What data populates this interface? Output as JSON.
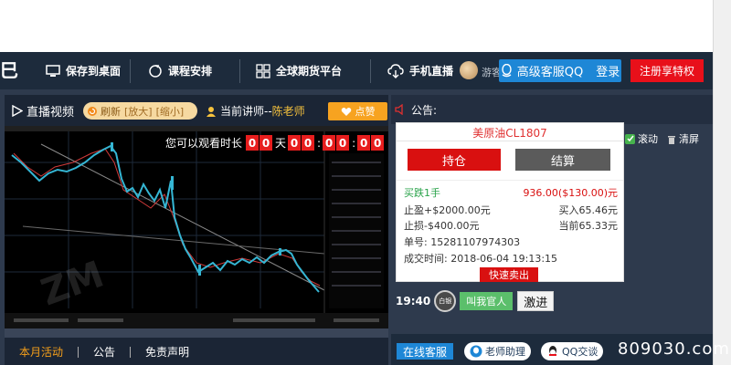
{
  "navbar": {
    "items": [
      {
        "label": "保存到桌面",
        "icon": "monitor-icon"
      },
      {
        "label": "课程安排",
        "icon": "refresh-cycle-icon"
      },
      {
        "label": "全球期货平台",
        "icon": "grid-icon"
      },
      {
        "label": "手机直播",
        "icon": "cloud-download-icon"
      }
    ],
    "user_text": "游客",
    "kefu_label": "高级客服QQ",
    "login_fragment": "登录",
    "register_label": "注册享特权"
  },
  "video": {
    "live_label": "直播视频",
    "refresh_label": "刷新",
    "zoom_in": "[放大]",
    "zoom_out": "[缩小]",
    "teacher_prefix": "当前讲师--",
    "teacher_name": "陈老师",
    "like_label": "点赞",
    "timer_label": "您可以观看时长",
    "timer_days": [
      "0",
      "0"
    ],
    "timer_day_unit": "天",
    "timer_hours": [
      "0",
      "0"
    ],
    "timer_minutes": [
      "0",
      "0"
    ],
    "timer_seconds": [
      "0",
      "0"
    ]
  },
  "bottom_tabs": [
    {
      "label": "本月活动",
      "active": true
    },
    {
      "label": "公告",
      "active": false
    },
    {
      "label": "免责声明",
      "active": false
    }
  ],
  "notice": {
    "title": "公告:",
    "scroll_label": "滚动",
    "clear_label": "清屏"
  },
  "trade_card": {
    "instrument": "美原油CL1807",
    "hold_label": "持仓",
    "settle_label": "结算",
    "action": "买跌1手",
    "price_line": "936.00($130.00)元",
    "take_profit": "止盈+$2000.00元",
    "buy_in": "买入65.46元",
    "stop_loss": "止损-$400.00元",
    "current": "当前65.33元",
    "order_no": "单号: 15281107974303",
    "deal_time": "成交时间: 2018-06-04 19:13:15",
    "fast_sell": "快速卖出"
  },
  "chat": {
    "time": "19:40",
    "badge_text": "白银",
    "call_label": "叫我官人",
    "fight_label": "激进"
  },
  "bottom_bar": {
    "online_label": "在线客服",
    "assistant_label": "老师助理",
    "qq_label": "QQ交谈"
  },
  "site_watermark": "809030.com",
  "colors": {
    "nav_bg": "#1d2b3c",
    "accent_blue": "#1e87d6",
    "accent_red": "#e8101a",
    "accent_orange": "#f7a320"
  }
}
